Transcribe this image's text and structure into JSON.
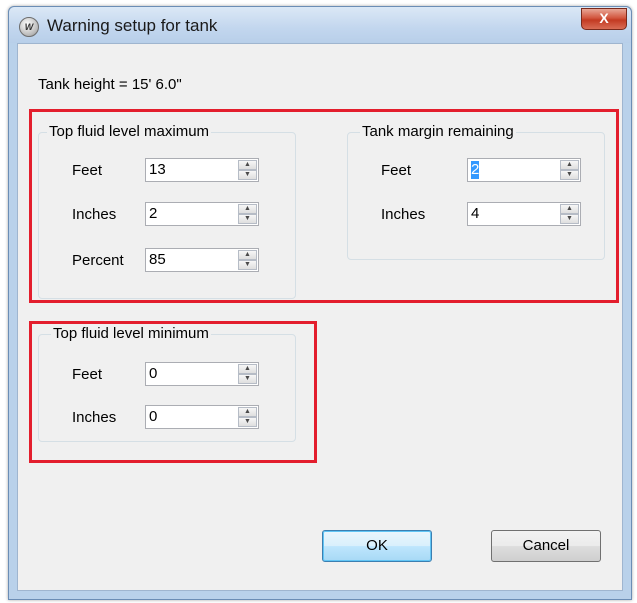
{
  "window": {
    "title": "Warning setup for tank",
    "close_label": "X"
  },
  "tank_height_text": "Tank height = 15' 6.0\"",
  "max_group": {
    "title": "Top fluid level maximum",
    "feet": {
      "label": "Feet",
      "value": "13"
    },
    "inches": {
      "label": "Inches",
      "value": "2"
    },
    "percent": {
      "label": "Percent",
      "value": "85"
    }
  },
  "margin_group": {
    "title": "Tank margin remaining",
    "feet": {
      "label": "Feet",
      "value": "2"
    },
    "inches": {
      "label": "Inches",
      "value": "4"
    }
  },
  "min_group": {
    "title": "Top fluid level minimum",
    "feet": {
      "label": "Feet",
      "value": "0"
    },
    "inches": {
      "label": "Inches",
      "value": "0"
    }
  },
  "buttons": {
    "ok": "OK",
    "cancel": "Cancel"
  },
  "colors": {
    "highlight_box": "#e31e2d",
    "selection": "#3399ff"
  },
  "icons": {
    "spin_up": "up-arrow-icon",
    "spin_down": "down-arrow-icon",
    "app": "app-logo-icon"
  }
}
